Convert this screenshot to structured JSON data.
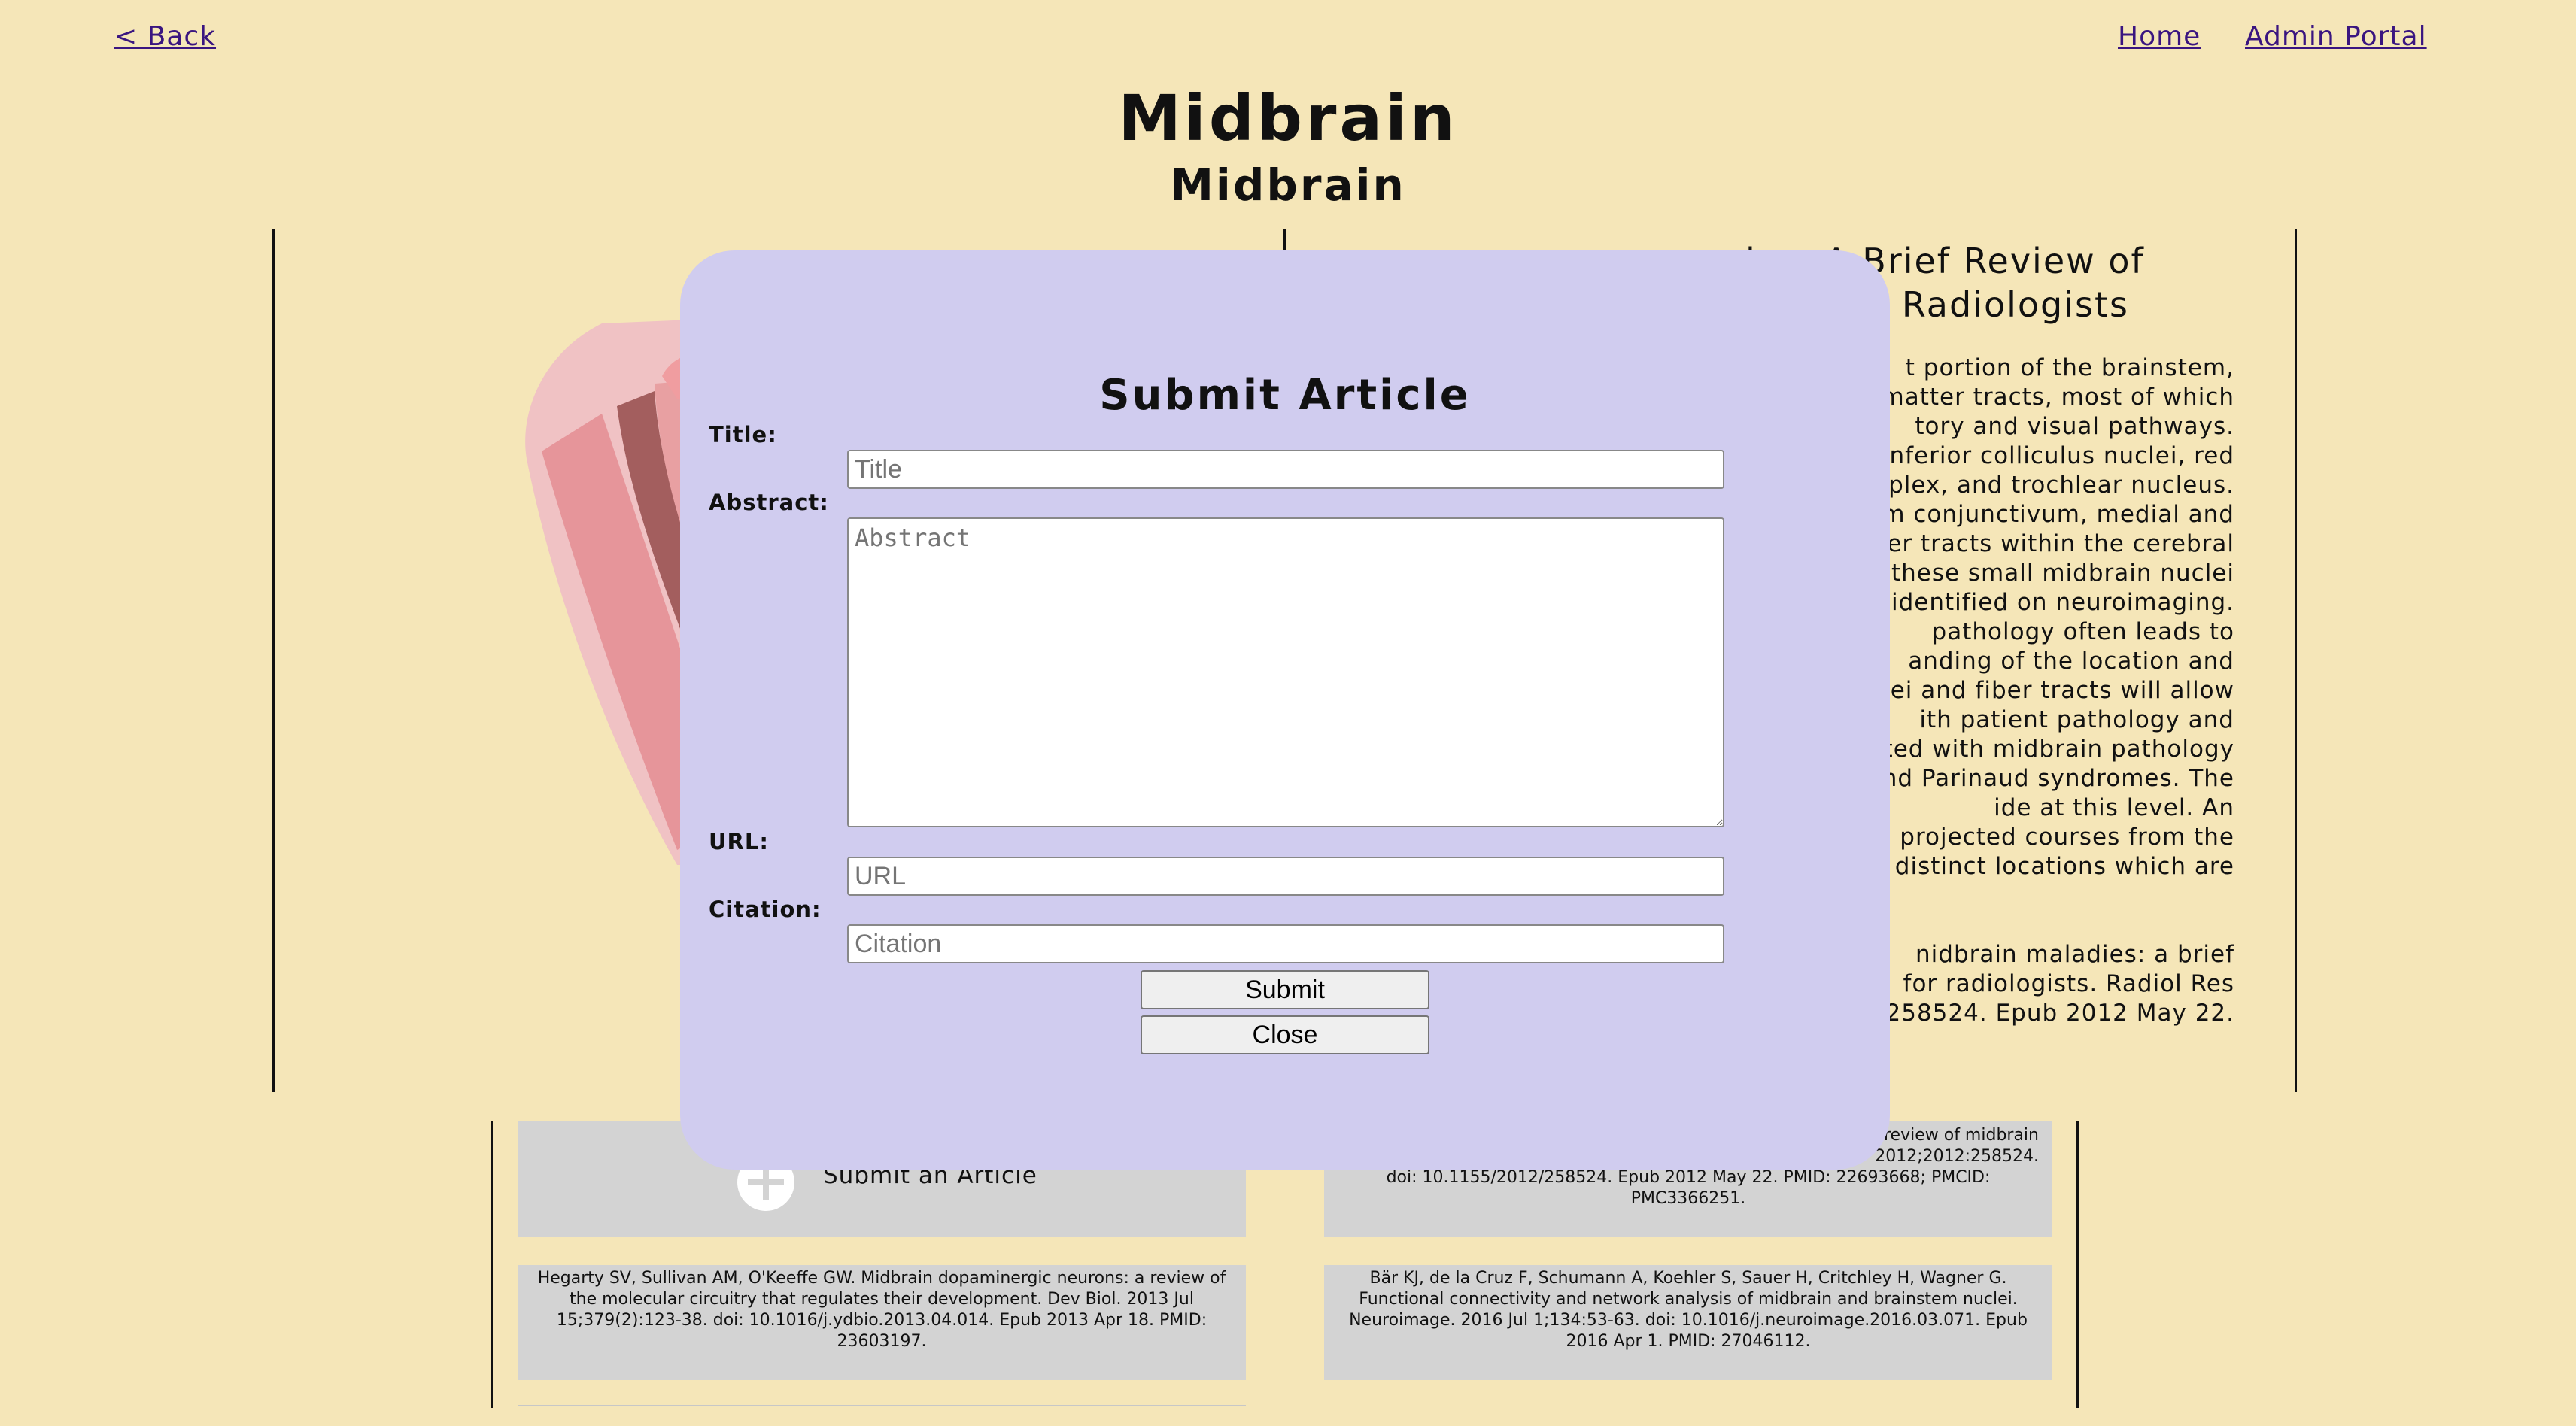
{
  "nav": {
    "back_label": "< Back",
    "home_label": "Home",
    "admin_label": "Admin Portal"
  },
  "page": {
    "title": "Midbrain",
    "subtitle": "Midbrain"
  },
  "article": {
    "title_visible": "ies: A Brief Review of\nlogy for Radiologists",
    "body_visible_lines": [
      "t portion of the brainstem,",
      "matter tracts, most of which",
      "tory and visual pathways.",
      "inferior colliculus nuclei, red",
      "mplex, and trochlear nucleus.",
      "nium conjunctivum, medial and",
      "fiber tracts within the cerebral",
      "f these small midbrain nuclei",
      "y identified on neuroimaging.",
      "pathology often leads to",
      "anding of the location and",
      "clei and fiber tracts will allow",
      "ith patient pathology and",
      "ted with midbrain pathology",
      ", and Parinaud syndromes. The",
      "ide at this level. An",
      "projected courses from the",
      "f distinct locations which are"
    ],
    "citation_visible_lines": [
      "nidbrain maladies: a brief",
      "for radiologists. Radiol Res",
      "258524. Epub 2012 May 22."
    ]
  },
  "cards": {
    "submit_label": "Submit an Article",
    "card_top_right_lines": [
      "review of midbrain",
      "2012;2012:258524.",
      "doi: 10.1155/2012/258524. Epub 2012 May 22. PMID: 22693668; PMCID:",
      "PMC3366251."
    ],
    "card_bottom_left": "Hegarty SV, Sullivan AM, O'Keeffe GW. Midbrain dopaminergic neurons: a review of the molecular circuitry that regulates their development. Dev Biol. 2013 Jul 15;379(2):123-38. doi: 10.1016/j.ydbio.2013.04.014. Epub 2013 Apr 18. PMID: 23603197.",
    "card_bottom_right": "Bär KJ, de la Cruz F, Schumann A, Koehler S, Sauer H, Critchley H, Wagner G. Functional connectivity and network analysis of midbrain and brainstem nuclei. Neuroimage. 2016 Jul 1;134:53-63. doi: 10.1016/j.neuroimage.2016.03.071. Epub 2016 Apr 1. PMID: 27046112."
  },
  "modal": {
    "title": "Submit Article",
    "title_label": "Title:",
    "title_placeholder": "Title",
    "abstract_label": "Abstract:",
    "abstract_placeholder": "Abstract",
    "url_label": "URL:",
    "url_placeholder": "URL",
    "citation_label": "Citation:",
    "citation_placeholder": "Citation",
    "submit_label": "Submit",
    "close_label": "Close"
  },
  "colors": {
    "background": "#f5e6b8",
    "modal": "#d0ccef",
    "link": "#3a1580",
    "card": "#d3d3d3"
  }
}
